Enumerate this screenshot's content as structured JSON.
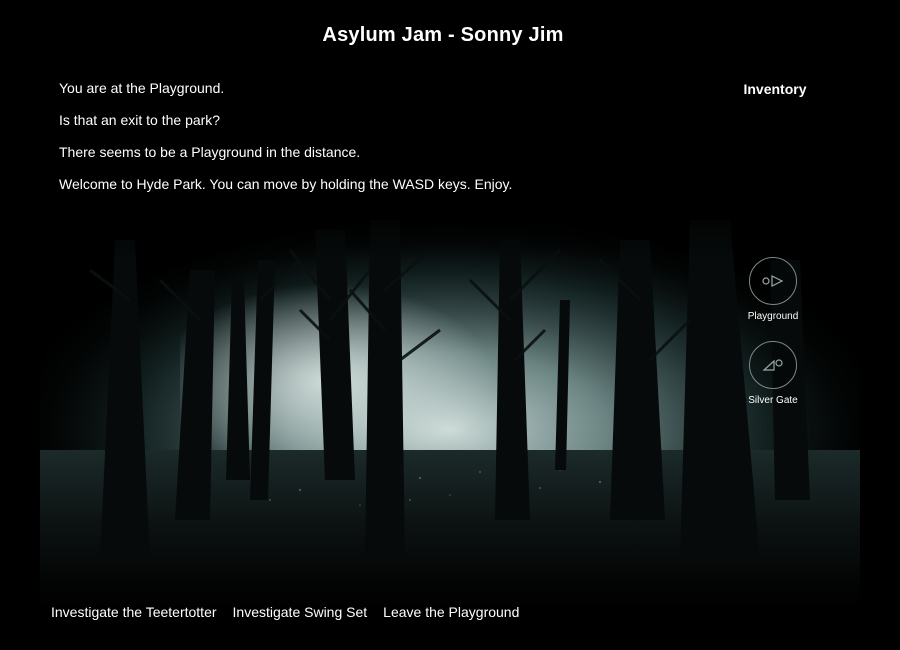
{
  "header": {
    "title": "Asylum Jam - Sonny Jim"
  },
  "log": [
    "You are at the Playground.",
    "Is that an exit to the park?",
    "There seems to be a Playground in the distance.",
    "Welcome to Hyde Park. You can move by holding the WASD keys. Enjoy."
  ],
  "inventory": {
    "title": "Inventory"
  },
  "exits": [
    {
      "label": "Playground",
      "icon": "exit-arrow-right-icon"
    },
    {
      "label": "Silver Gate",
      "icon": "exit-arrow-left-icon"
    }
  ],
  "actions": [
    "Investigate the Teetertotter",
    "Investigate Swing Set",
    "Leave the Playground"
  ],
  "colors": {
    "background": "#000000",
    "text": "#ffffff",
    "mist": "#b8d2d0"
  }
}
